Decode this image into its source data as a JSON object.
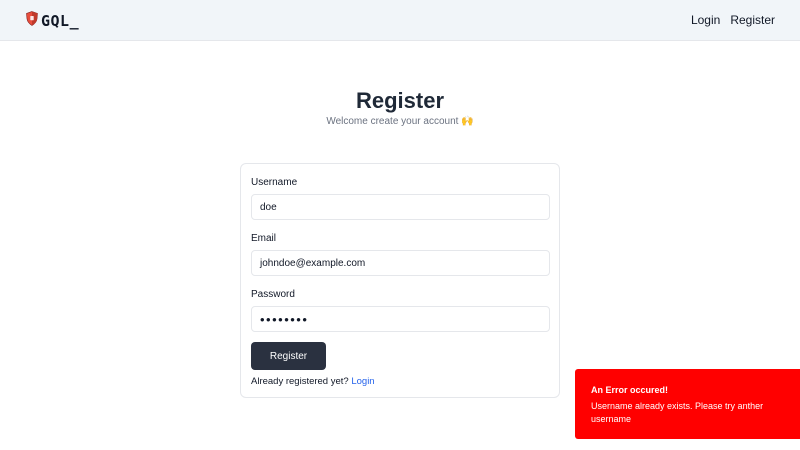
{
  "navbar": {
    "brand_text": "GQL_",
    "links": [
      "Login",
      "Register"
    ]
  },
  "header": {
    "title": "Register",
    "subtitle": "Welcome create your account 🙌"
  },
  "form": {
    "username": {
      "label": "Username",
      "value": "doe"
    },
    "email": {
      "label": "Email",
      "value": "johndoe@example.com"
    },
    "password": {
      "label": "Password",
      "value": "••••••••"
    },
    "submit_label": "Register",
    "footer_text": "Already registered yet?",
    "footer_link": "Login"
  },
  "toast": {
    "title": "An Error occured!",
    "message": "Username already exists. Please try anther username"
  },
  "colors": {
    "navbar_bg": "#f1f5f9",
    "button_bg": "#2a3140",
    "link": "#2563eb",
    "toast_bg": "#ff0000"
  },
  "icons": {
    "logo": "shield-icon"
  }
}
